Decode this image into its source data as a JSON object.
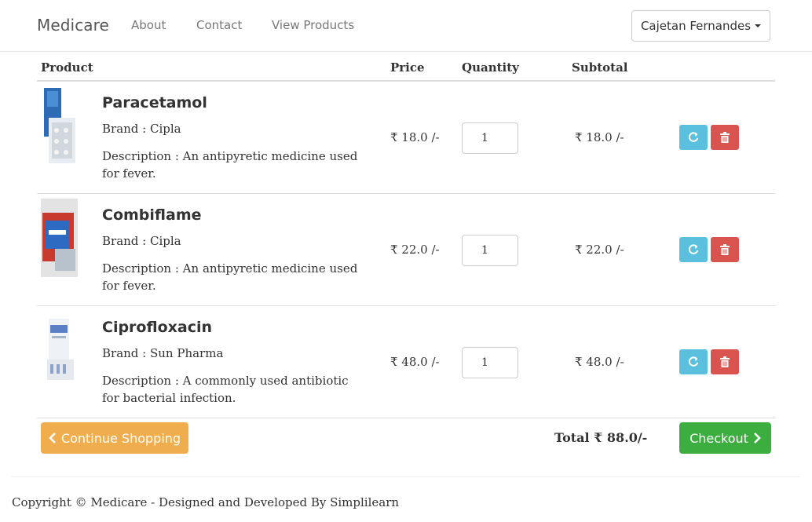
{
  "navbar": {
    "brand": "Medicare",
    "links": [
      "About",
      "Contact",
      "View Products"
    ],
    "user": "Cajetan Fernandes"
  },
  "table": {
    "headers": {
      "product": "Product",
      "price": "Price",
      "quantity": "Quantity",
      "subtotal": "Subtotal"
    },
    "rows": [
      {
        "name": "Paracetamol",
        "brand": "Brand : Cipla",
        "description": "Description : An antipyretic medicine used for fever.",
        "price": "₹ 18.0 /-",
        "quantity": "1",
        "subtotal": "₹ 18.0 /-"
      },
      {
        "name": "Combiflame",
        "brand": "Brand : Cipla",
        "description": "Description : An antipyretic medicine used for fever.",
        "price": "₹ 22.0 /-",
        "quantity": "1",
        "subtotal": "₹ 22.0 /-"
      },
      {
        "name": "Ciprofloxacin",
        "brand": "Brand : Sun Pharma",
        "description": "Description : A commonly used antibiotic for bacterial infection.",
        "price": "₹ 48.0 /-",
        "quantity": "1",
        "subtotal": "₹ 48.0 /-"
      }
    ]
  },
  "actions": {
    "continue_label": "Continue Shopping",
    "total": "Total ₹ 88.0/-",
    "checkout_label": "Checkout"
  },
  "footer": {
    "copyright": "Copyright © Medicare - Designed and Developed By Simplilearn"
  },
  "icons": {
    "refresh": "refresh-icon",
    "delete": "trash-icon",
    "chevron_left": "chevron-left-icon",
    "chevron_right": "chevron-right-icon",
    "caret": "caret-down-icon"
  },
  "colors": {
    "info": "#5bc0de",
    "danger": "#d9534f",
    "warning": "#f0ad4e",
    "success": "#3cae3f"
  }
}
